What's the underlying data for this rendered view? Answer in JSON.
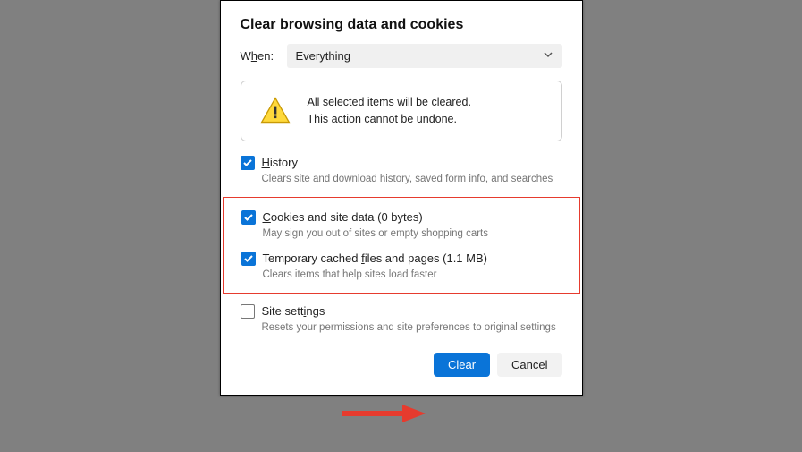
{
  "title": "Clear browsing data and cookies",
  "when": {
    "label_pre": "W",
    "label_u": "h",
    "label_post": "en:",
    "value": "Everything"
  },
  "warning": {
    "line1": "All selected items will be cleared.",
    "line2": "This action cannot be undone."
  },
  "options": {
    "history": {
      "pre": "",
      "u": "H",
      "post": "istory",
      "desc": "Clears site and download history, saved form info, and searches",
      "checked": true
    },
    "cookies": {
      "pre": "",
      "u": "C",
      "post": "ookies and site data (0 bytes)",
      "desc": "May sign you out of sites or empty shopping carts",
      "checked": true
    },
    "cache": {
      "pre": "Temporary cached ",
      "u": "f",
      "post": "iles and pages (1.1 MB)",
      "desc": "Clears items that help sites load faster",
      "checked": true
    },
    "site_settings": {
      "pre": "Site sett",
      "u": "i",
      "post": "ngs",
      "desc": "Resets your permissions and site preferences to original settings",
      "checked": false
    }
  },
  "buttons": {
    "clear": "Clear",
    "cancel": "Cancel"
  }
}
